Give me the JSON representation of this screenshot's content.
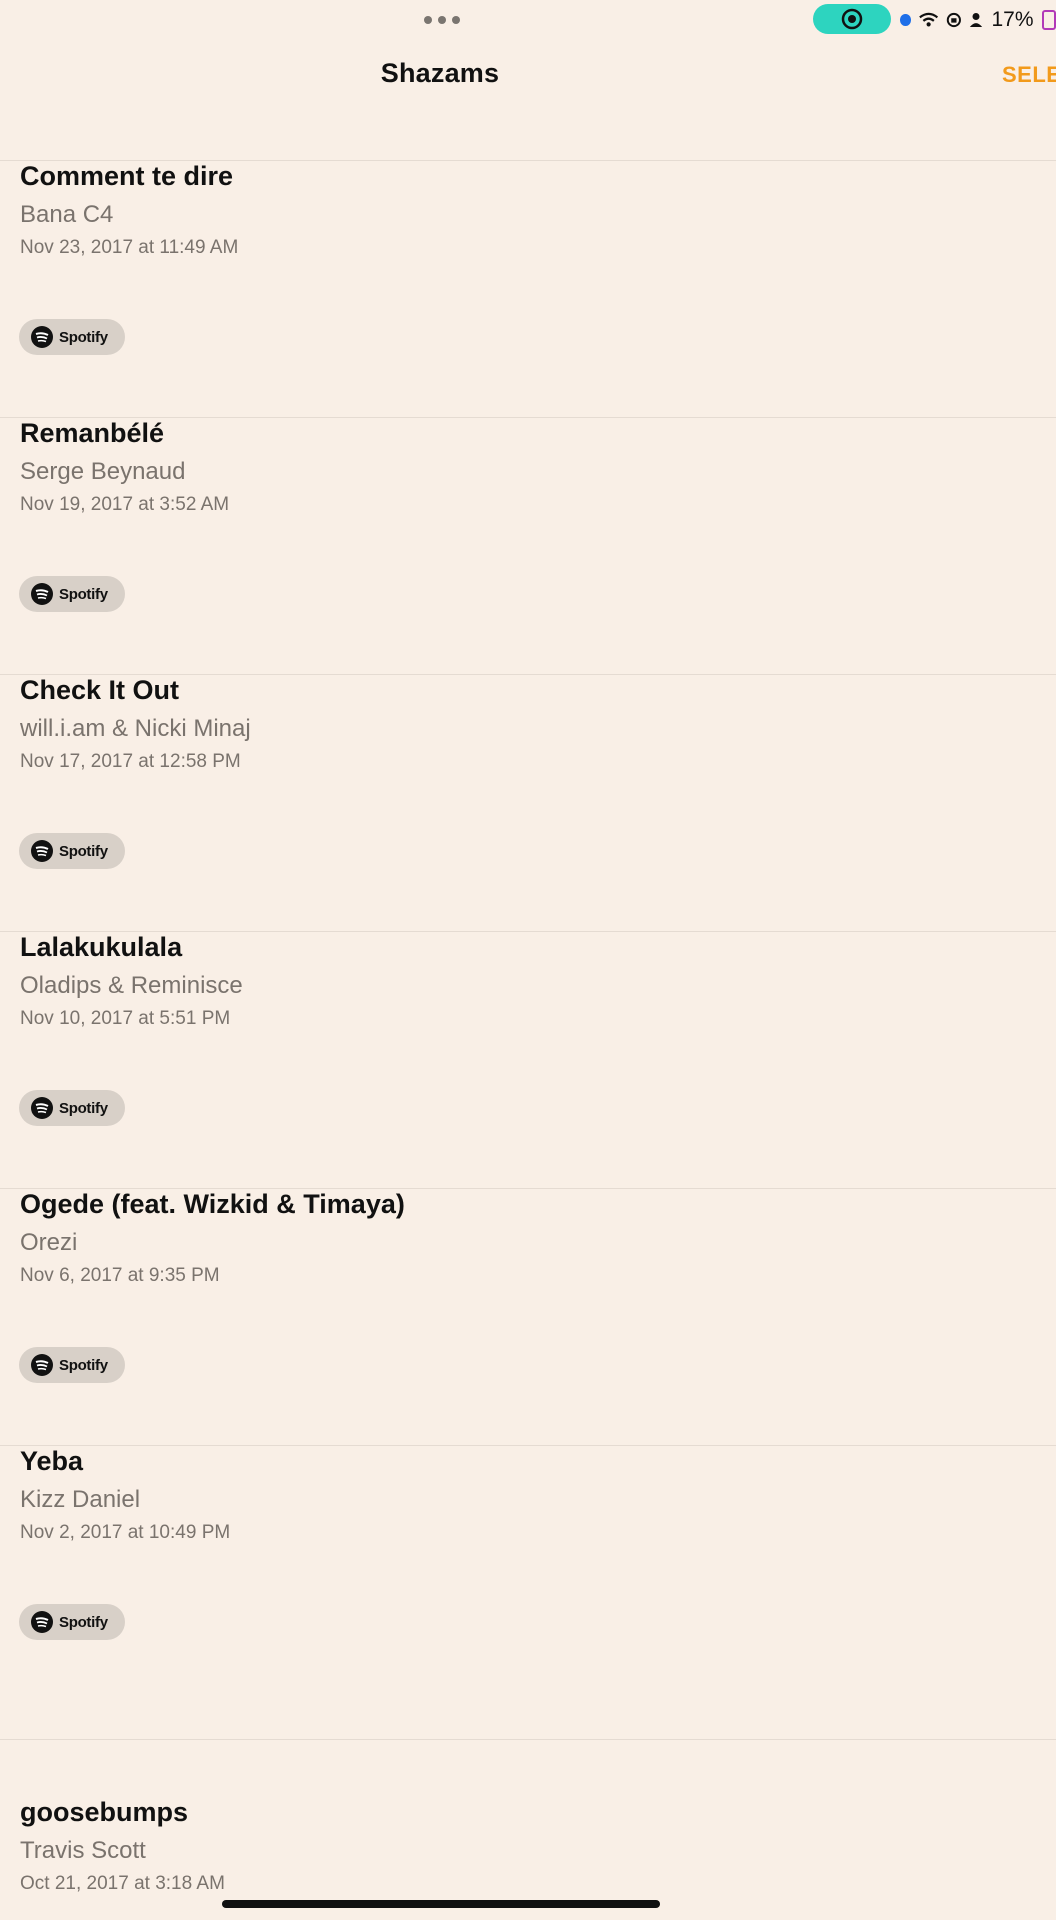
{
  "status_bar": {
    "battery_percent": "17%",
    "icons": [
      "multitask-dots-icon",
      "screen-record-icon",
      "location-dot-icon",
      "wifi-icon",
      "lock-rotation-icon",
      "person-icon",
      "battery-icon"
    ]
  },
  "header": {
    "title": "Shazams",
    "select_label": "SELE"
  },
  "spotify_label": "Spotify",
  "items": [
    {
      "title": "Comment te dire",
      "artist": "Bana C4",
      "date": "Nov 23, 2017 at 11:49 AM"
    },
    {
      "title": "Remanbélé",
      "artist": "Serge Beynaud",
      "date": "Nov 19, 2017 at 3:52 AM"
    },
    {
      "title": "Check It Out",
      "artist": "will.i.am & Nicki Minaj",
      "date": "Nov 17, 2017 at 12:58 PM"
    },
    {
      "title": "Lalakukulala",
      "artist": "Oladips & Reminisce",
      "date": "Nov 10, 2017 at 5:51 PM"
    },
    {
      "title": "Ogede (feat. Wizkid & Timaya)",
      "artist": "Orezi",
      "date": "Nov 6, 2017 at 9:35 PM"
    },
    {
      "title": "Yeba",
      "artist": "Kizz Daniel",
      "date": "Nov 2, 2017 at 10:49 PM"
    }
  ],
  "last_item": {
    "title": "goosebumps",
    "artist": "Travis Scott",
    "date": "Oct 21, 2017 at 3:18 AM"
  },
  "colors": {
    "background": "#f9efe6",
    "accent": "#f29a1b",
    "record_pill": "#2dd4bf"
  }
}
